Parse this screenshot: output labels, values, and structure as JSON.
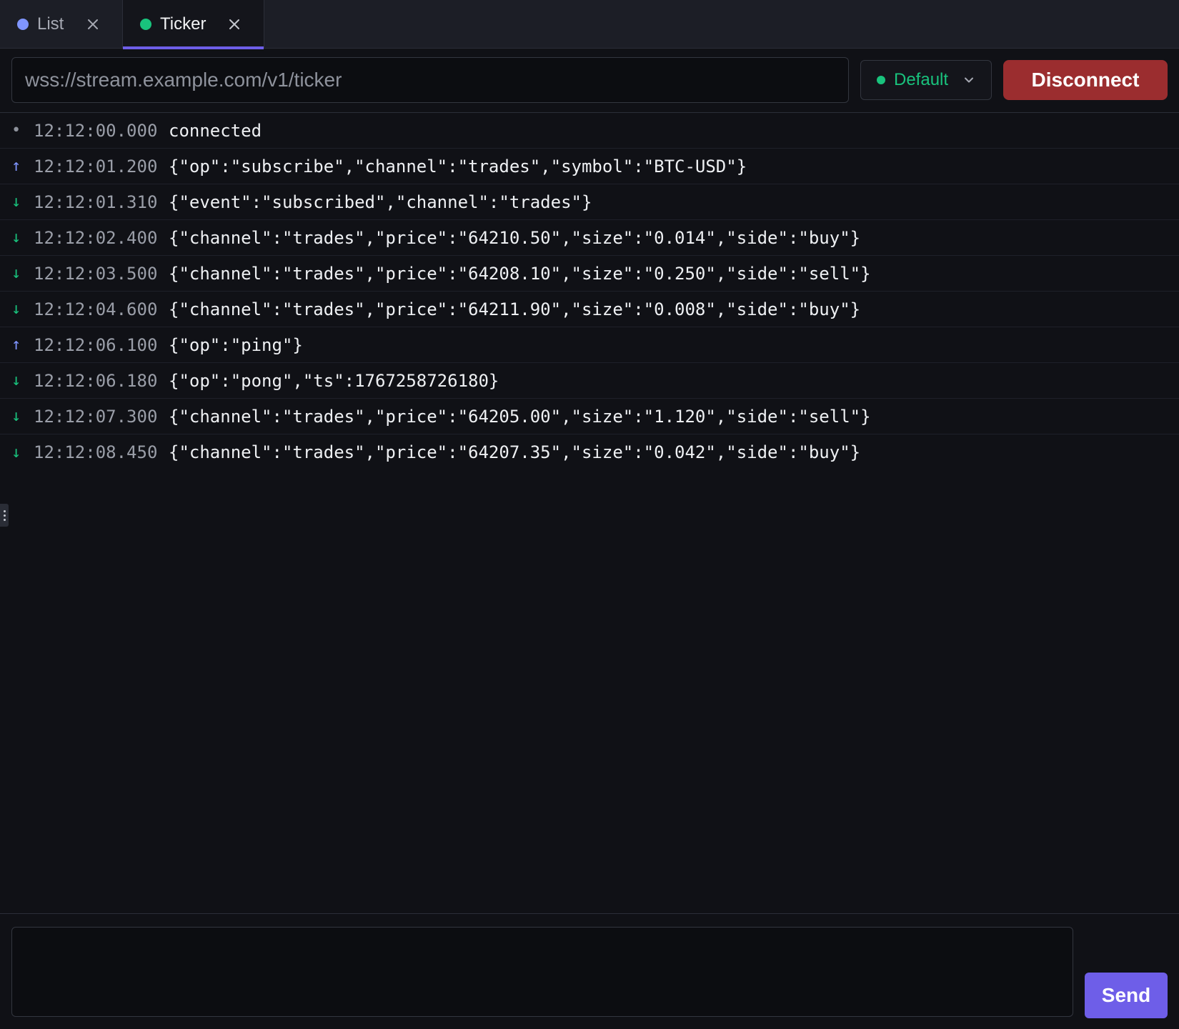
{
  "tabs": [
    {
      "label": "List",
      "status_color": "#7f95ff",
      "active": false
    },
    {
      "label": "Ticker",
      "status_color": "#19c37d",
      "active": true
    }
  ],
  "toolbar": {
    "url_value": "wss://stream.example.com/v1/ticker",
    "environment": {
      "label": "Default",
      "status_color": "#19c37d"
    },
    "disconnect_label": "Disconnect"
  },
  "log": [
    {
      "direction": "system",
      "arrow": "•",
      "time": "12:12:00.000",
      "message": "connected"
    },
    {
      "direction": "out",
      "arrow": "↑",
      "time": "12:12:01.200",
      "message": "{\"op\":\"subscribe\",\"channel\":\"trades\",\"symbol\":\"BTC-USD\"}"
    },
    {
      "direction": "in",
      "arrow": "↓",
      "time": "12:12:01.310",
      "message": "{\"event\":\"subscribed\",\"channel\":\"trades\"}"
    },
    {
      "direction": "in",
      "arrow": "↓",
      "time": "12:12:02.400",
      "message": "{\"channel\":\"trades\",\"price\":\"64210.50\",\"size\":\"0.014\",\"side\":\"buy\"}"
    },
    {
      "direction": "in",
      "arrow": "↓",
      "time": "12:12:03.500",
      "message": "{\"channel\":\"trades\",\"price\":\"64208.10\",\"size\":\"0.250\",\"side\":\"sell\"}"
    },
    {
      "direction": "in",
      "arrow": "↓",
      "time": "12:12:04.600",
      "message": "{\"channel\":\"trades\",\"price\":\"64211.90\",\"size\":\"0.008\",\"side\":\"buy\"}"
    },
    {
      "direction": "out",
      "arrow": "↑",
      "time": "12:12:06.100",
      "message": "{\"op\":\"ping\"}"
    },
    {
      "direction": "in",
      "arrow": "↓",
      "time": "12:12:06.180",
      "message": "{\"op\":\"pong\",\"ts\":1767258726180}"
    },
    {
      "direction": "in",
      "arrow": "↓",
      "time": "12:12:07.300",
      "message": "{\"channel\":\"trades\",\"price\":\"64205.00\",\"size\":\"1.120\",\"side\":\"sell\"}"
    },
    {
      "direction": "in",
      "arrow": "↓",
      "time": "12:12:08.450",
      "message": "{\"channel\":\"trades\",\"price\":\"64207.35\",\"size\":\"0.042\",\"side\":\"buy\"}"
    }
  ],
  "composer": {
    "message_value": "",
    "send_label": "Send"
  },
  "colors": {
    "accent": "#6e5ee8",
    "danger": "#9b2d2f",
    "incoming": "#19c37d",
    "outgoing": "#7f95ff"
  }
}
